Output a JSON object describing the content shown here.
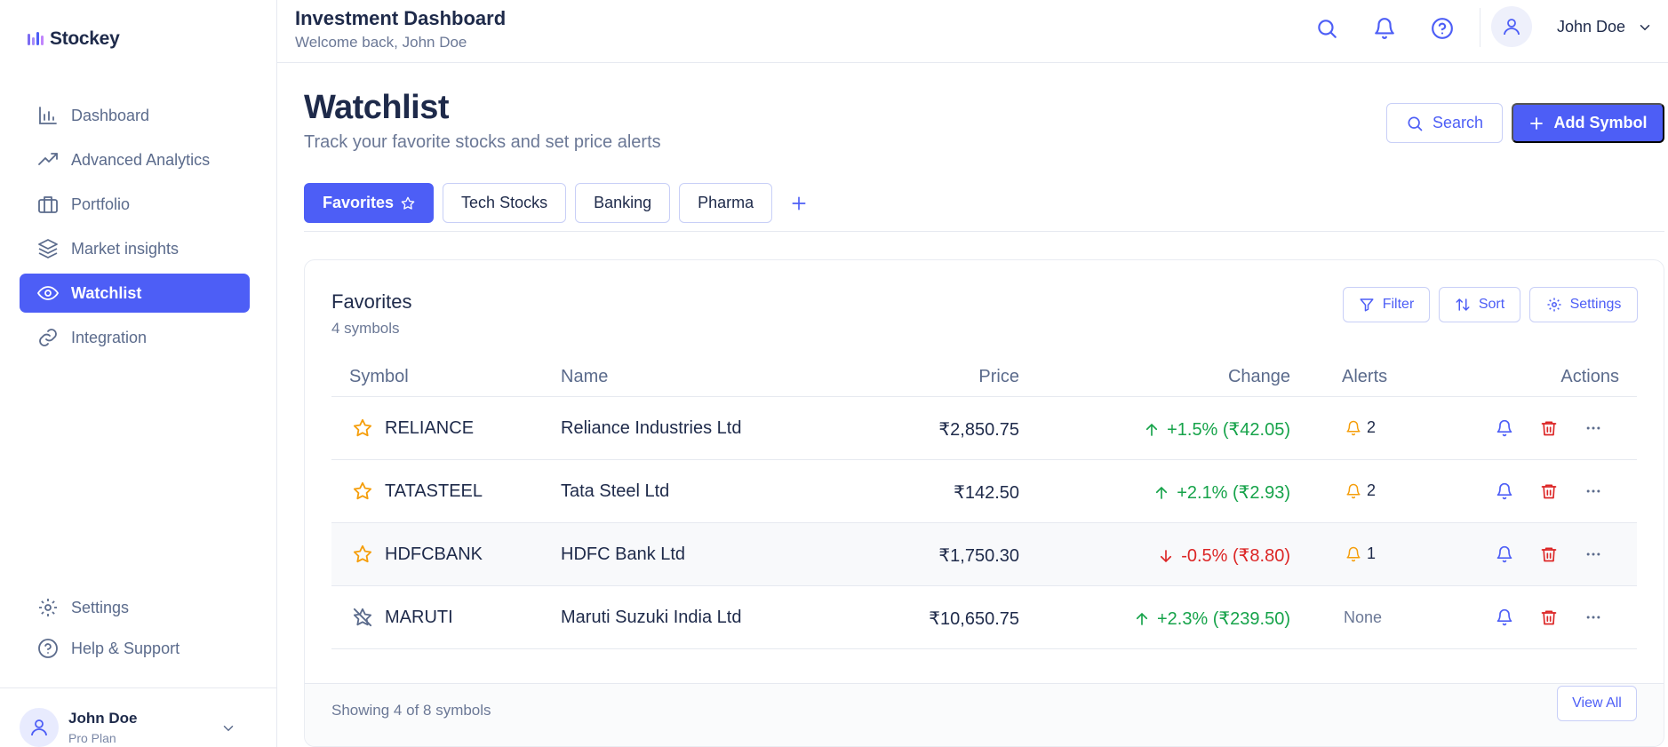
{
  "brand": {
    "name": "Stockey",
    "accent": "#4d5ef6"
  },
  "sidebar": {
    "items": [
      {
        "label": "Dashboard",
        "icon": "bar-chart-icon"
      },
      {
        "label": "Advanced Analytics",
        "icon": "trending-up-icon"
      },
      {
        "label": "Portfolio",
        "icon": "briefcase-icon"
      },
      {
        "label": "Market insights",
        "icon": "layers-icon"
      },
      {
        "label": "Watchlist",
        "icon": "eye-icon",
        "active": true
      },
      {
        "label": "Integration",
        "icon": "link-icon"
      }
    ],
    "bottom": [
      {
        "label": "Settings",
        "icon": "gear-icon"
      },
      {
        "label": "Help & Support",
        "icon": "help-circle-icon"
      }
    ],
    "user": {
      "name": "John Doe",
      "plan": "Pro Plan"
    }
  },
  "header": {
    "title": "Investment Dashboard",
    "subtitle": "Welcome back, John Doe",
    "user_name": "John Doe"
  },
  "page": {
    "title": "Watchlist",
    "subtitle": "Track your favorite stocks and set price alerts",
    "search_label": "Search",
    "add_label": "Add Symbol"
  },
  "tabs": [
    {
      "label": "Favorites",
      "active": true
    },
    {
      "label": "Tech Stocks"
    },
    {
      "label": "Banking"
    },
    {
      "label": "Pharma"
    }
  ],
  "card": {
    "title": "Favorites",
    "count": "4 symbols",
    "filter_label": "Filter",
    "sort_label": "Sort",
    "settings_label": "Settings",
    "columns": [
      "Symbol",
      "Name",
      "Price",
      "Change",
      "Alerts",
      "Actions"
    ],
    "rows": [
      {
        "symbol": "RELIANCE",
        "name": "Reliance Industries Ltd",
        "price": "₹2,850.75",
        "change": "+1.5% (₹42.05)",
        "direction": "up",
        "alerts": "2",
        "favorite": true
      },
      {
        "symbol": "TATASTEEL",
        "name": "Tata Steel Ltd",
        "price": "₹142.50",
        "change": "+2.1% (₹2.93)",
        "direction": "up",
        "alerts": "2",
        "favorite": true
      },
      {
        "symbol": "HDFCBANK",
        "name": "HDFC Bank Ltd",
        "price": "₹1,750.30",
        "change": "-0.5% (₹8.80)",
        "direction": "down",
        "alerts": "1",
        "favorite": true
      },
      {
        "symbol": "MARUTI",
        "name": "Maruti Suzuki India Ltd",
        "price": "₹10,650.75",
        "change": "+2.3% (₹239.50)",
        "direction": "up",
        "alerts": "None",
        "favorite": false
      }
    ],
    "footer_text": "Showing 4 of 8 symbols",
    "view_all_label": "View All"
  },
  "colors": {
    "positive": "#16a34a",
    "negative": "#dc2626",
    "alert": "#f59e0b",
    "delete": "#dc2626"
  }
}
